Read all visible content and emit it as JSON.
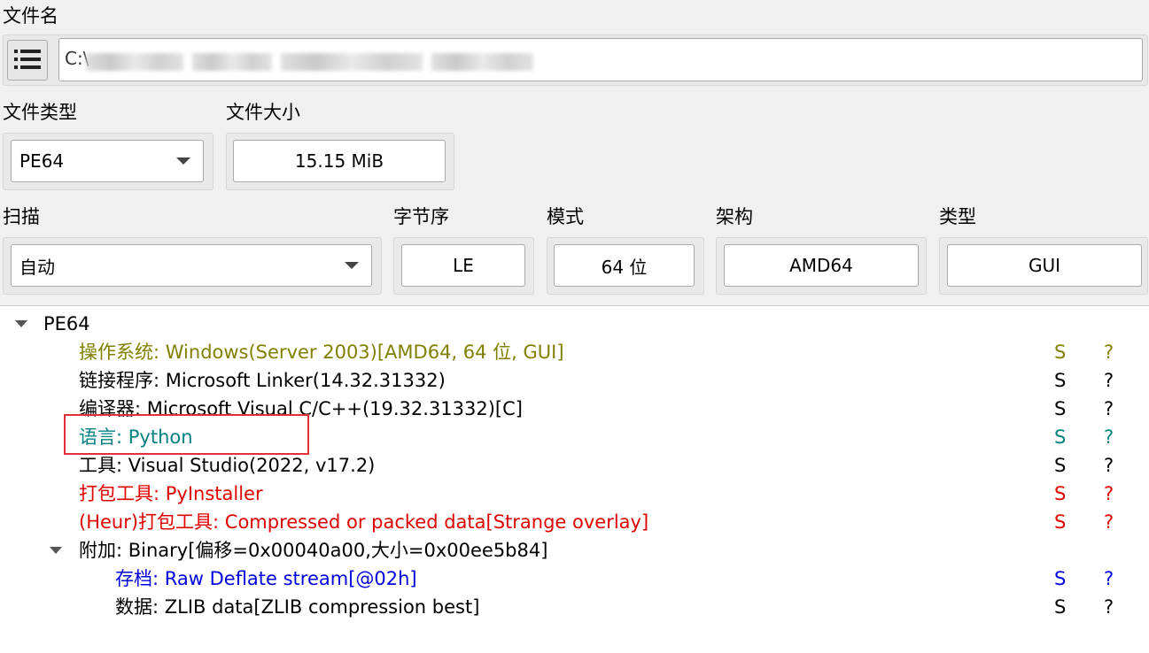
{
  "file": {
    "label": "文件名",
    "path_visible": "C:\\"
  },
  "file_type": {
    "label": "文件类型",
    "value": "PE64"
  },
  "file_size": {
    "label": "文件大小",
    "value": "15.15 MiB"
  },
  "scan": {
    "label": "扫描",
    "value": "自动"
  },
  "endianness": {
    "label": "字节序",
    "value": "LE"
  },
  "mode": {
    "label": "模式",
    "value": "64 位"
  },
  "arch": {
    "label": "架构",
    "value": "AMD64"
  },
  "type": {
    "label": "类型",
    "value": "GUI"
  },
  "tree": {
    "root": "PE64",
    "rows": [
      {
        "text": "操作系统: Windows(Server 2003)[AMD64, 64 位, GUI]",
        "s": "S",
        "q": "?",
        "color": "#808000"
      },
      {
        "text": "链接程序: Microsoft Linker(14.32.31332)",
        "s": "S",
        "q": "?",
        "color": "#000000"
      },
      {
        "text": "编译器: Microsoft Visual C/C++(19.32.31332)[C]",
        "s": "S",
        "q": "?",
        "color": "#000000"
      },
      {
        "text": "语言: Python",
        "s": "S",
        "q": "?",
        "color": "#008080"
      },
      {
        "text": "工具: Visual Studio(2022, v17.2)",
        "s": "S",
        "q": "?",
        "color": "#000000"
      },
      {
        "text": "打包工具: PyInstaller",
        "s": "S",
        "q": "?",
        "color": "#e00000"
      },
      {
        "text": "(Heur)打包工具: Compressed or packed data[Strange overlay]",
        "s": "S",
        "q": "?",
        "color": "#e00000"
      }
    ],
    "overlay": {
      "text": "附加: Binary[偏移=0x00040a00,大小=0x00ee5b84]",
      "children": [
        {
          "text": "存档: Raw Deflate stream[@02h]",
          "s": "S",
          "q": "?",
          "color": "#0000e0"
        },
        {
          "text": "数据: ZLIB data[ZLIB compression best]",
          "s": "S",
          "q": "?",
          "color": "#000000"
        }
      ]
    }
  }
}
